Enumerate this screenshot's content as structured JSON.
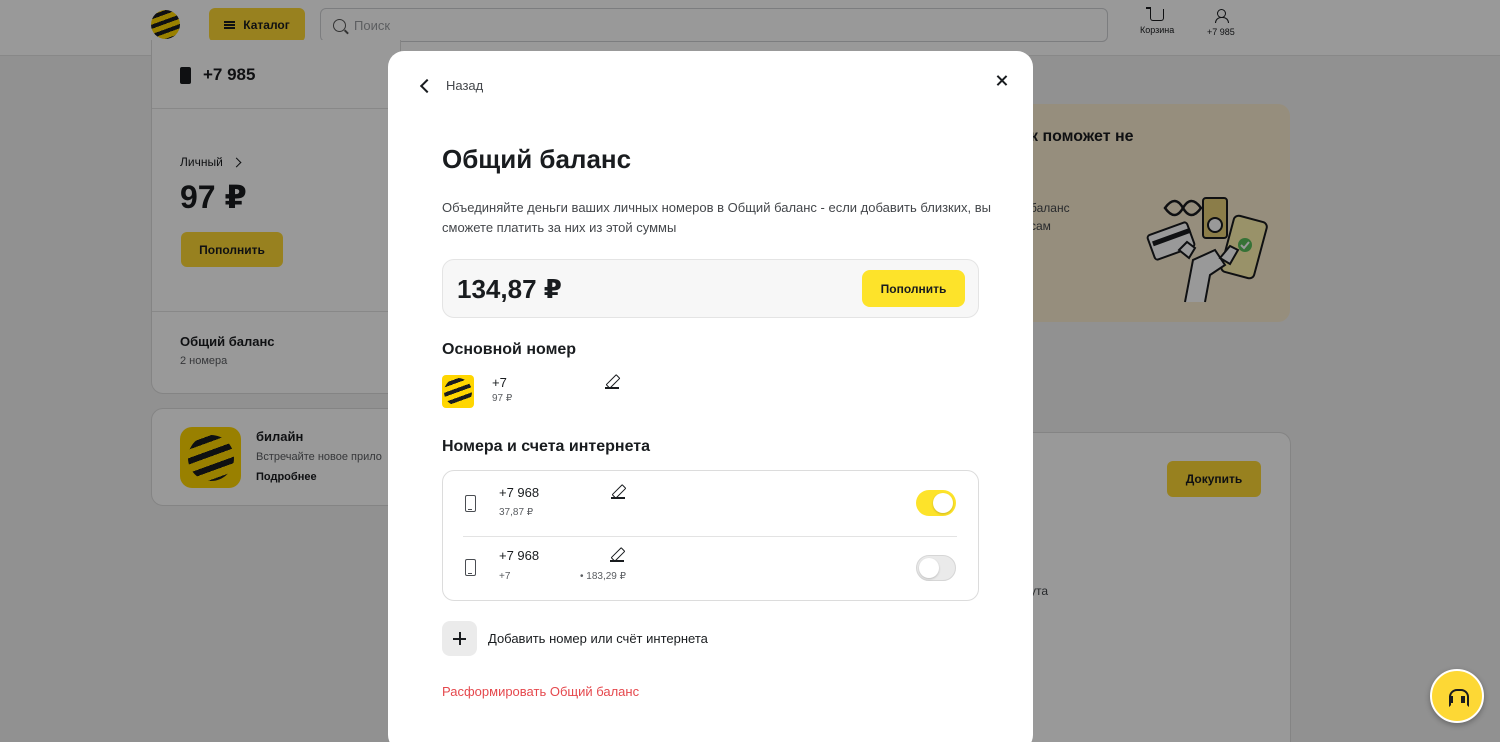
{
  "header": {
    "catalog_label": "Каталог",
    "search_placeholder": "Поиск",
    "cart_label": "Корзина",
    "account_label": "+7 985"
  },
  "background": {
    "account_phone": "+7 985",
    "personal_label": "Личный",
    "personal_balance": "97 ₽",
    "topup_label": "Пополнить",
    "shared_title": "Общий баланс",
    "shared_sub": "2 номера",
    "app_title": "билайн",
    "app_sub": "Встречайте новое прило",
    "app_more": "Подробнее",
    "promo_title": "к поможет не",
    "promo_line1": "баланс",
    "promo_line2": "сам",
    "buy_label": "Докупить",
    "buy_text": "ута"
  },
  "modal": {
    "back_label": "Назад",
    "title": "Общий баланс",
    "description": "Объединяйте деньги ваших личных номеров в Общий баланс - если добавить близких, вы сможете платить за них из этой суммы",
    "balance": "134,87 ₽",
    "topup_label": "Пополнить",
    "main_heading": "Основной номер",
    "main_number": "+7",
    "main_balance": "97 ₽",
    "lines_heading": "Номера и счета интернета",
    "lines": [
      {
        "number": "+7 968",
        "detail": "37,87 ₽",
        "extra": "",
        "enabled": true
      },
      {
        "number": "+7 968",
        "detail": "+7",
        "extra": "• 183,29 ₽",
        "enabled": false
      }
    ],
    "add_label": "Добавить номер или счёт интернета",
    "dissolve_label": "Расформировать Общий баланс"
  },
  "colors": {
    "accent_yellow": "#fde32a",
    "danger_red": "#e5484d",
    "overlay": "rgba(0,0,0,0.4)"
  }
}
